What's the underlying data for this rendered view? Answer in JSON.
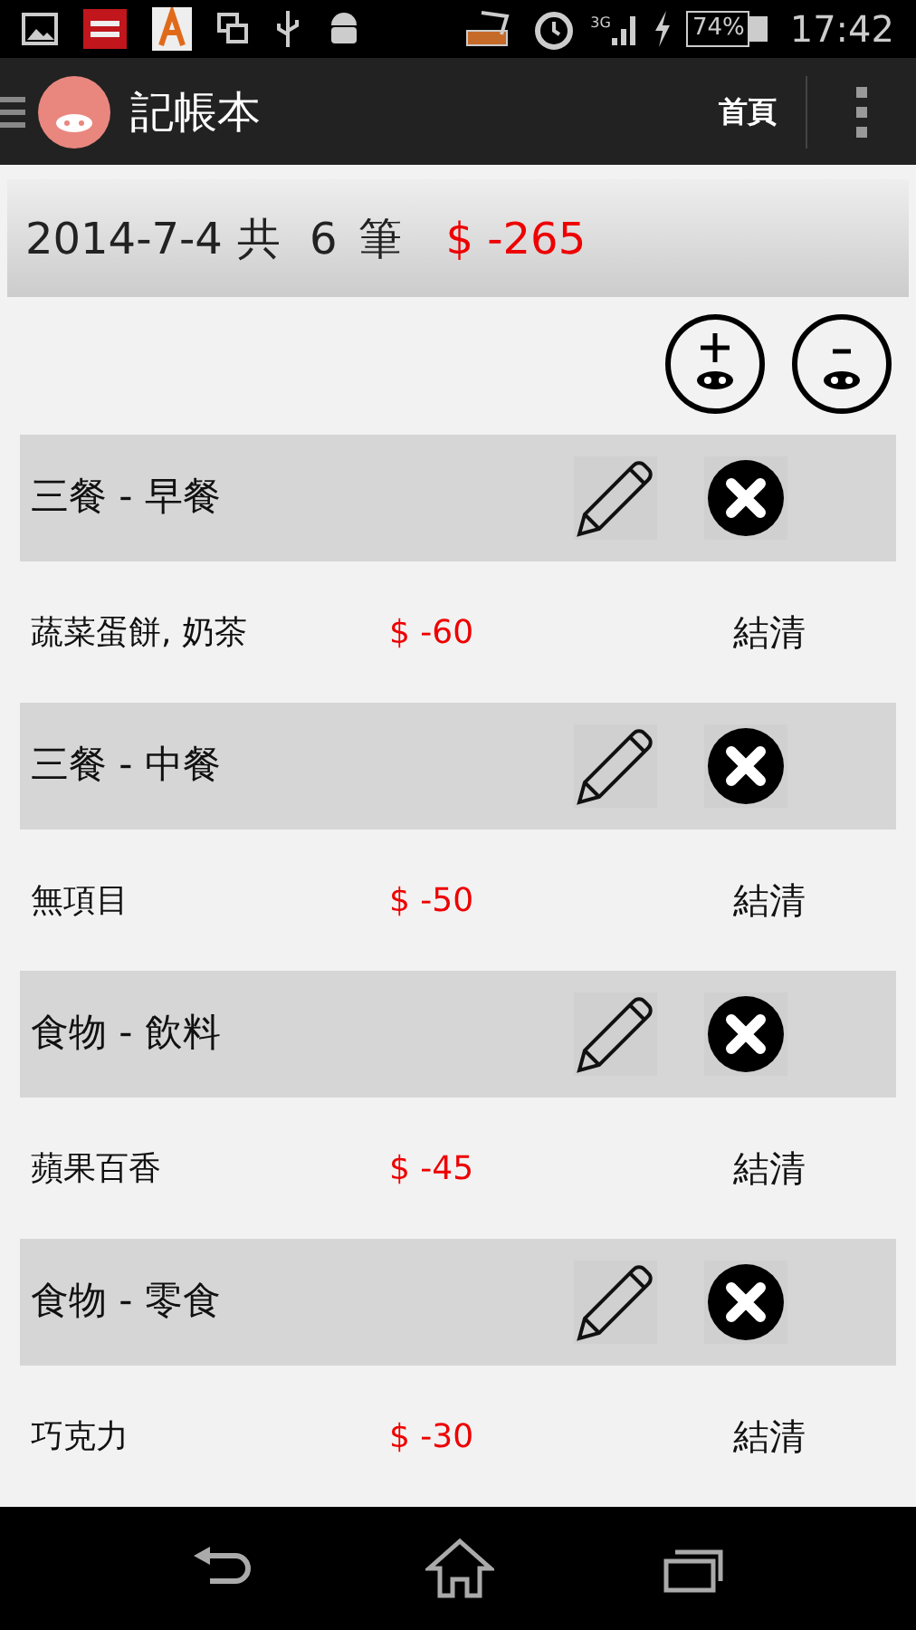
{
  "status_bar": {
    "network": "3G",
    "battery": "74%",
    "time": "17:42"
  },
  "action_bar": {
    "title": "記帳本",
    "home_button": "首頁"
  },
  "summary": {
    "date": "2014-7-4",
    "count_label": "共",
    "count": "6",
    "count_unit": "筆",
    "total": "$ -265"
  },
  "entries": [
    {
      "category": "三餐 - 早餐",
      "item": "蔬菜蛋餅, 奶茶",
      "amount": "$ -60",
      "status": "結清"
    },
    {
      "category": "三餐 - 中餐",
      "item": "無項目",
      "amount": "$ -50",
      "status": "結清"
    },
    {
      "category": "食物 - 飲料",
      "item": "蘋果百香",
      "amount": "$ -45",
      "status": "結清"
    },
    {
      "category": "食物 - 零食",
      "item": "巧克力",
      "amount": "$ -30",
      "status": "結清"
    }
  ]
}
